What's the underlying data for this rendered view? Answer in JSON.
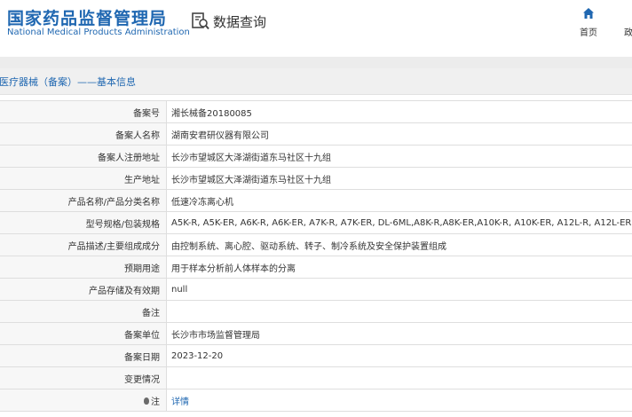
{
  "header": {
    "brand_cn": "国家药品监督管理局",
    "brand_en": "National Medical Products Administration",
    "query_label": "数据查询",
    "nav_home": "首页",
    "nav_next": "政"
  },
  "breadcrumb": "医疗器械（备案）——基本信息",
  "rows": [
    {
      "label": "备案号",
      "value": "湘长械备20180085"
    },
    {
      "label": "备案人名称",
      "value": "湖南安君研仪器有限公司"
    },
    {
      "label": "备案人注册地址",
      "value": "长沙市望城区大泽湖街道东马社区十九组"
    },
    {
      "label": "生产地址",
      "value": "长沙市望城区大泽湖街道东马社区十九组"
    },
    {
      "label": "产品名称/产品分类名称",
      "value": "低速冷冻离心机"
    },
    {
      "label": "型号规格/包装规格",
      "value": "A5K-R, A5K-ER, A6K-R, A6K-ER, A7K-R, A7K-ER, DL-6ML,A8K-R,A8K-ER,A10K-R, A10K-ER, A12L-R, A12L-ER"
    },
    {
      "label": "产品描述/主要组成成分",
      "value": "由控制系统、离心腔、驱动系统、转子、制冷系统及安全保护装置组成"
    },
    {
      "label": "预期用途",
      "value": "用于样本分析前人体样本的分离"
    },
    {
      "label": "产品存储及有效期",
      "value": "null"
    },
    {
      "label": "备注",
      "value": ""
    },
    {
      "label": "备案单位",
      "value": "长沙市市场监督管理局"
    },
    {
      "label": "备案日期",
      "value": "2023-12-20"
    },
    {
      "label": "变更情况",
      "value": ""
    },
    {
      "label": "注",
      "value": "详情"
    }
  ],
  "colors": {
    "brand": "#1f67b1",
    "label_bg": "#f7f7f7",
    "border": "#dedede"
  },
  "icons": {
    "query": "document-search-icon",
    "home": "home-icon",
    "note": "lightbulb-icon"
  }
}
